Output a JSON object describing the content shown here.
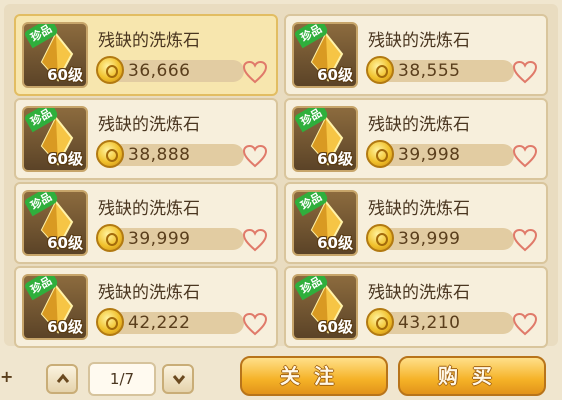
{
  "items": [
    {
      "name": "残缺的洗炼石",
      "price": "36,666",
      "level": "60级",
      "tag": "珍品",
      "selected": true
    },
    {
      "name": "残缺的洗炼石",
      "price": "38,555",
      "level": "60级",
      "tag": "珍品",
      "selected": false
    },
    {
      "name": "残缺的洗炼石",
      "price": "38,888",
      "level": "60级",
      "tag": "珍品",
      "selected": false
    },
    {
      "name": "残缺的洗炼石",
      "price": "39,998",
      "level": "60级",
      "tag": "珍品",
      "selected": false
    },
    {
      "name": "残缺的洗炼石",
      "price": "39,999",
      "level": "60级",
      "tag": "珍品",
      "selected": false
    },
    {
      "name": "残缺的洗炼石",
      "price": "39,999",
      "level": "60级",
      "tag": "珍品",
      "selected": false
    },
    {
      "name": "残缺的洗炼石",
      "price": "42,222",
      "level": "60级",
      "tag": "珍品",
      "selected": false
    },
    {
      "name": "残缺的洗炼石",
      "price": "43,210",
      "level": "60级",
      "tag": "珍品",
      "selected": false
    }
  ],
  "pagination": {
    "page_text": "1/7"
  },
  "buttons": {
    "follow": "关注",
    "buy": "购买"
  },
  "colors": {
    "tag_green": "#2faf3c",
    "heart_red": "#e07a6a",
    "gold": "#f5b227"
  }
}
